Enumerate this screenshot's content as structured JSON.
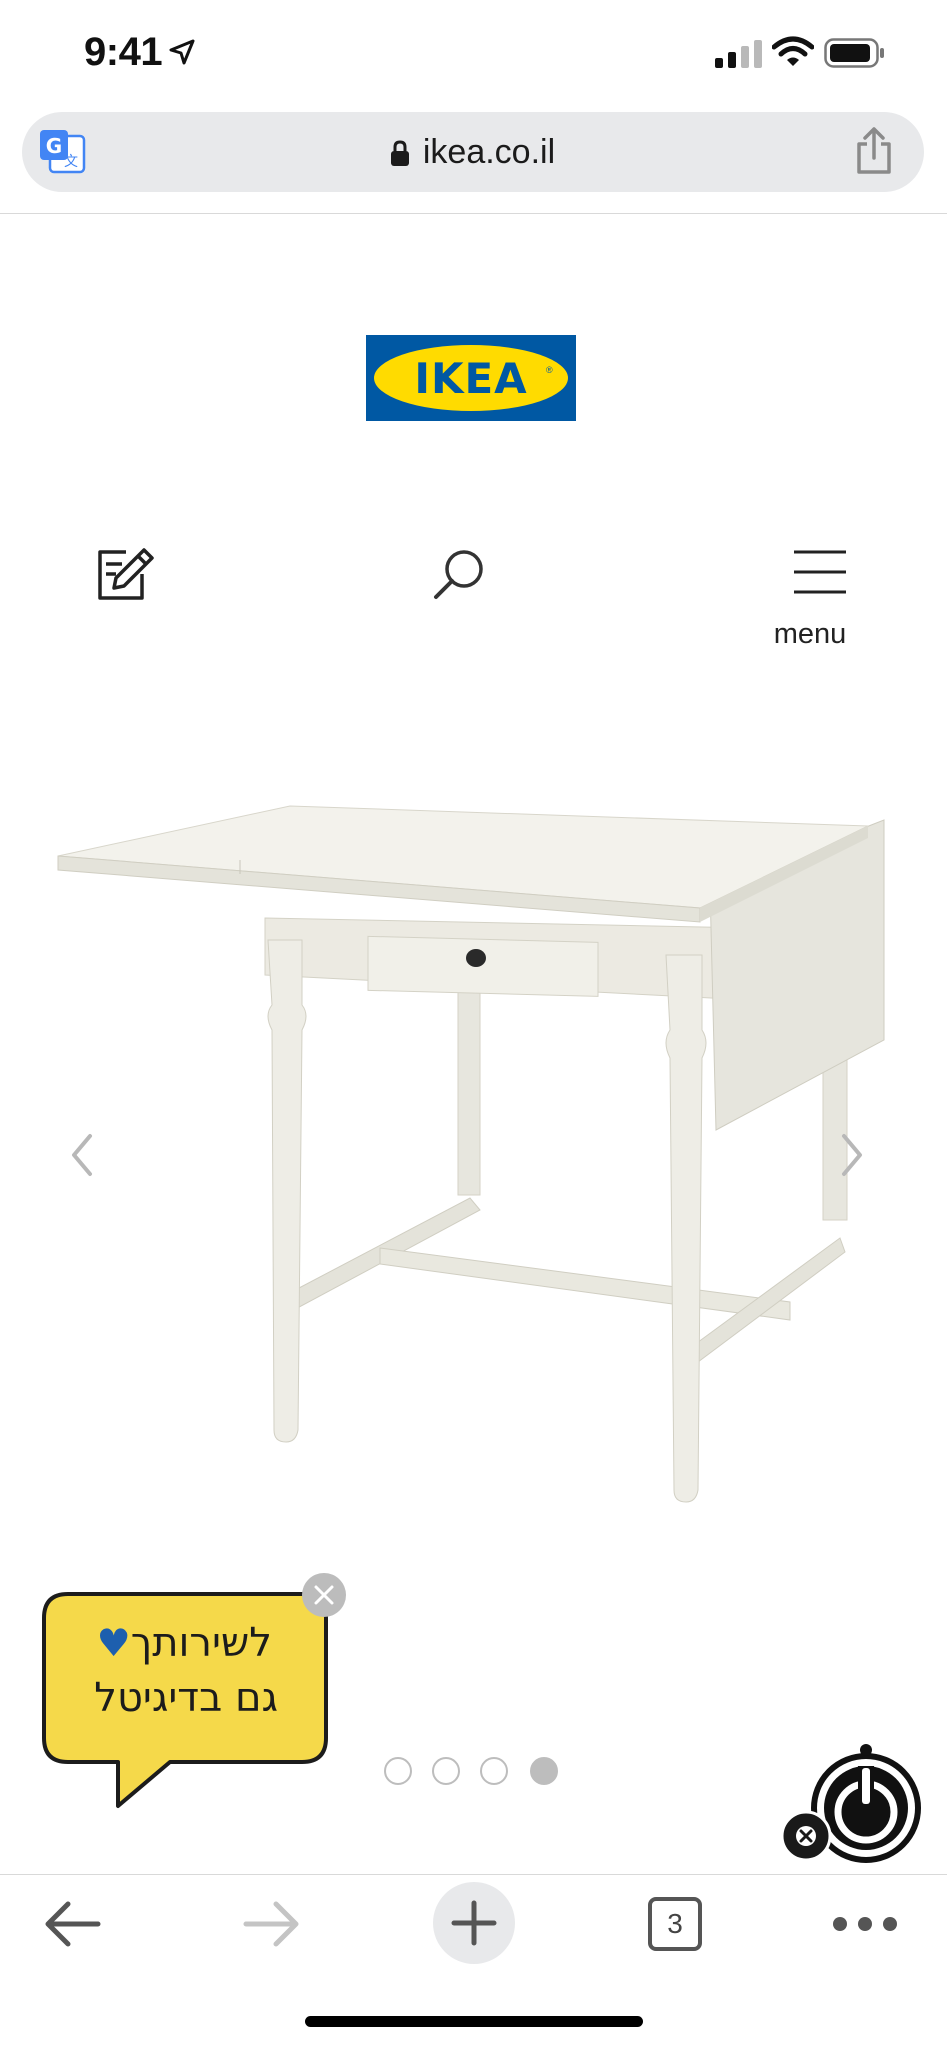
{
  "status_bar": {
    "time": "9:41",
    "icons": [
      "location-arrow-icon",
      "cellular-signal-icon",
      "wifi-icon",
      "battery-icon"
    ]
  },
  "browser": {
    "url": "ikea.co.il",
    "icons": [
      "google-translate-icon",
      "lock-icon",
      "share-icon"
    ],
    "toolbar": {
      "icons": [
        "back-arrow-icon",
        "forward-arrow-icon",
        "plus-icon",
        "tabs-icon",
        "more-icon"
      ],
      "tab_count": "3"
    }
  },
  "header": {
    "logo_text": "IKEA",
    "logo_colors": {
      "background": "#0058a3",
      "oval": "#ffdb00"
    },
    "icons": [
      "shopping-list-icon",
      "search-icon",
      "hamburger-menu-icon"
    ],
    "menu_label": "menu"
  },
  "gallery": {
    "image": "white drop-leaf table with drawer",
    "slide_count": 4,
    "active_slide": 4,
    "icons": [
      "chevron-left-icon",
      "chevron-right-icon"
    ]
  },
  "promo": {
    "line1": "לשירותך",
    "line2": "גם בדיגיטל",
    "heart": "♥",
    "colors": {
      "bubble": "#f5d94a",
      "heart": "#1d5fae"
    }
  },
  "accessibility_widget": {
    "icons": [
      "accessibility-power-icon",
      "close-icon"
    ]
  }
}
